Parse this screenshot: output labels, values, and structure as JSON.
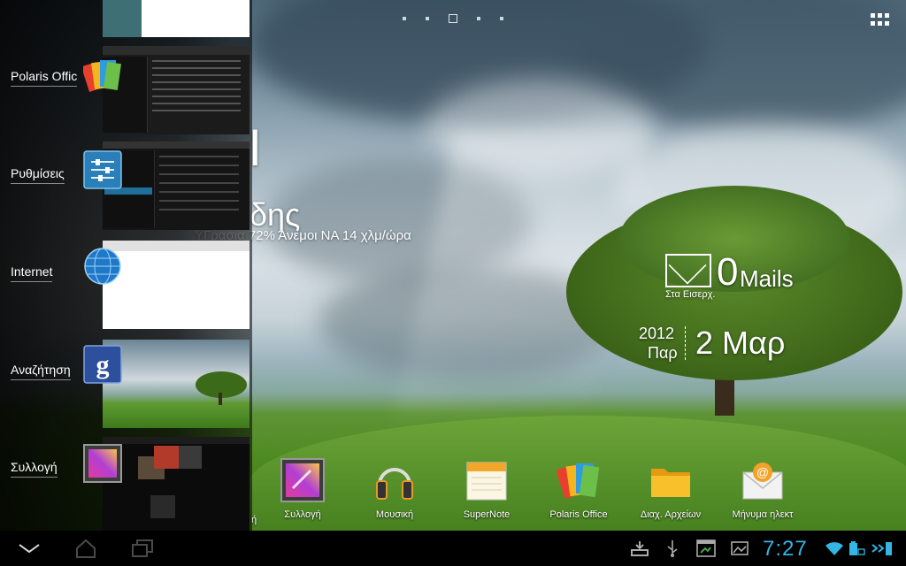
{
  "home": {
    "pages": 5,
    "current_page": 3
  },
  "weather_widget": {
    "temp_fragment": "l",
    "title_fragment": "δης",
    "detail_fragment": "ΥΓρασια 72% Άνεμοι ΝΑ 14 χλμ/ώρα"
  },
  "mail_widget": {
    "count": "0",
    "label": "Mails",
    "folder": "Στα Εισερχ."
  },
  "date_widget": {
    "year": "2012",
    "weekday": "Παρ",
    "date": "2 Μαρ"
  },
  "recents": [
    {
      "label": "Polaris Offic",
      "icon": "polaris-office-icon"
    },
    {
      "label": "Ρυθμίσεις",
      "icon": "settings-icon"
    },
    {
      "label": "Internet",
      "icon": "globe-icon"
    },
    {
      "label": "Αναζήτηση",
      "icon": "google-search-icon"
    },
    {
      "label": "Συλλογή",
      "icon": "gallery-icon"
    }
  ],
  "dock": [
    {
      "label": "Συλλογή",
      "icon": "gallery-icon"
    },
    {
      "label": "Μουσική",
      "icon": "headphones-icon"
    },
    {
      "label": "SuperNote",
      "icon": "notepad-icon"
    },
    {
      "label": "Polaris Office",
      "icon": "polaris-office-icon"
    },
    {
      "label": "Διαχ. Αρχείων",
      "icon": "folder-icon"
    },
    {
      "label": "Μήνυμα ηλεκτ",
      "icon": "email-icon"
    }
  ],
  "dock_cut_label": "ή",
  "status": {
    "time": "7:27",
    "clock_color": "#33b5e5"
  }
}
